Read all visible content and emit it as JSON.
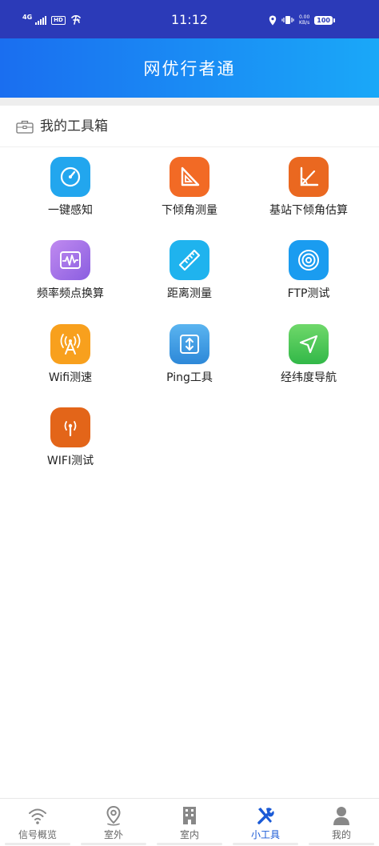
{
  "status_bar": {
    "network_label": "4G",
    "hd_label": "HD",
    "time": "11:12",
    "speed_value": "0.00",
    "speed_unit": "KB/s",
    "battery": "100"
  },
  "header": {
    "title": "网优行者通"
  },
  "section": {
    "title": "我的工具箱",
    "icon": "toolbox-icon"
  },
  "tools": [
    {
      "label": "一键感知",
      "icon": "speedometer-icon",
      "color": "#22a6ee"
    },
    {
      "label": "下倾角测量",
      "icon": "set-square-icon",
      "color": "#f26a25"
    },
    {
      "label": "基站下倾角估算",
      "icon": "angle-icon",
      "color": "#ea6820"
    },
    {
      "label": "频率频点换算",
      "icon": "waveform-icon",
      "color": "#a070e8"
    },
    {
      "label": "距离测量",
      "icon": "ruler-icon",
      "color": "#1fb3ee"
    },
    {
      "label": "FTP测试",
      "icon": "target-icon",
      "color": "#1a9cf0"
    },
    {
      "label": "Wifi测速",
      "icon": "signal-tower-icon",
      "color": "#f8a01d"
    },
    {
      "label": "Ping工具",
      "icon": "arrows-vertical-icon",
      "color": "#3a9ee6"
    },
    {
      "label": "经纬度导航",
      "icon": "navigation-arrow-icon",
      "color": "#4ac85a"
    },
    {
      "label": "WIFI测试",
      "icon": "antenna-icon",
      "color": "#e36519"
    }
  ],
  "tabbar": {
    "items": [
      {
        "label": "信号概览",
        "icon": "wifi-icon",
        "active": false
      },
      {
        "label": "室外",
        "icon": "location-pin-icon",
        "active": false
      },
      {
        "label": "室内",
        "icon": "building-icon",
        "active": false
      },
      {
        "label": "小工具",
        "icon": "tools-icon",
        "active": true
      },
      {
        "label": "我的",
        "icon": "user-icon",
        "active": false
      }
    ],
    "active_color": "#1a5ad6",
    "inactive_color": "#888888"
  }
}
